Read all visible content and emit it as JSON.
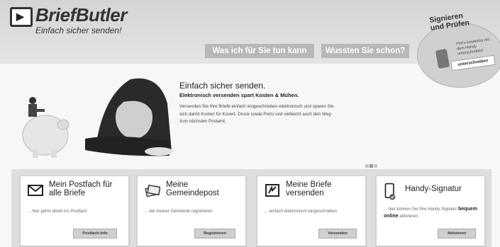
{
  "header": {
    "brand": "BriefButler",
    "tagline": "Einfach sicher senden!",
    "nav_tabs": [
      {
        "label": "Was ich für Sie tun kann"
      },
      {
        "label": "Wussten Sie schon?"
      }
    ]
  },
  "sign_badge": {
    "title_line1": "Signieren",
    "title_line2": "und Prüfen",
    "description": "PDFs kostenlos mit dem Handy unterschreiben",
    "button": "unterschreiben"
  },
  "hero": {
    "headline": "Einfach sicher senden.",
    "subheadline": "Elektronisch versenden spart Kosten & Mühen.",
    "body": "Versenden Sie Ihre Briefe einfach eingeschrieben elektronisch und sparen Sie sich damit Kosten für Kuvert, Druck sowie Porto und vielleicht auch den Weg zum nächsten Postamt."
  },
  "cards": [
    {
      "title": "Mein Postfach für alle Briefe",
      "description": "... hier gehts direkt ins Postfach",
      "button": "Postfach-Info",
      "icon": "envelope-icon"
    },
    {
      "title": "Meine Gemeindepost",
      "description": "... bei meiner Gemeinde registrieren",
      "button": "Registrieren",
      "icon": "mail-stack-icon"
    },
    {
      "title": "Meine Briefe versenden",
      "description": "... einfach elektronisch eingeschrieben",
      "button": "Versenden",
      "icon": "send-letter-icon"
    },
    {
      "title": "Handy-Signatur",
      "description": "... hier können Sie Ihre Handy Signatur",
      "description_bold": "bequem online",
      "description_end": "aktivieren.",
      "button": "Aktivieren",
      "icon": "phone-check-icon"
    }
  ]
}
